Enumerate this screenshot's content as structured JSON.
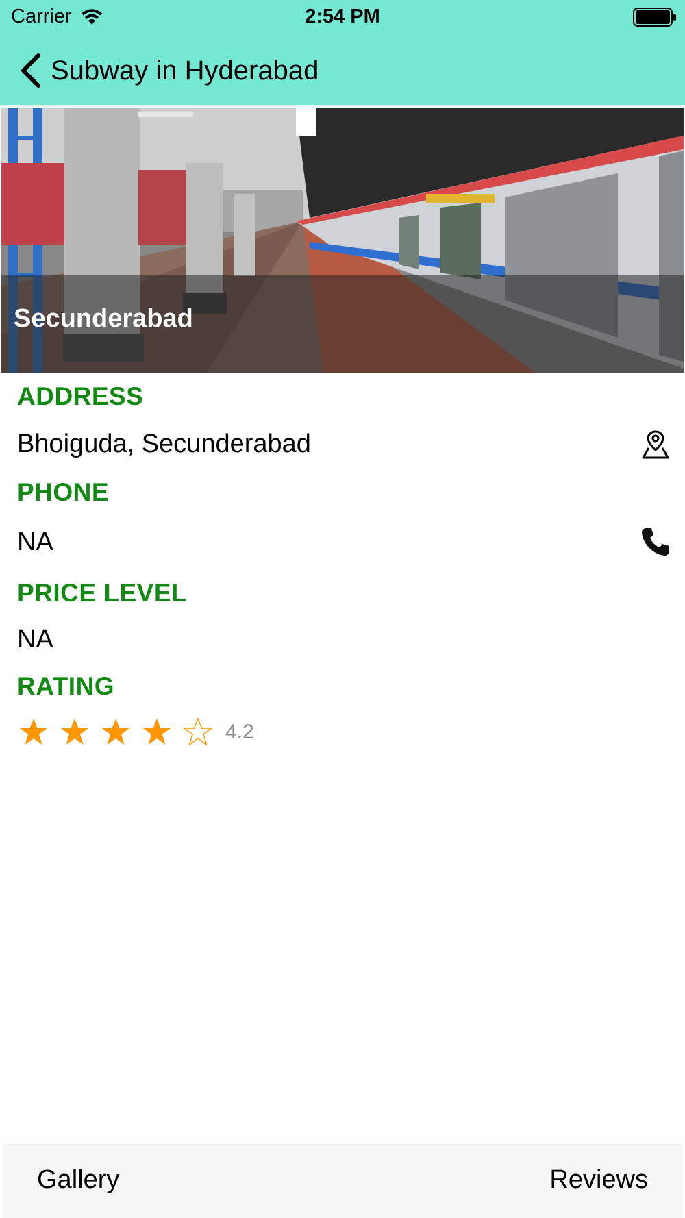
{
  "status_bar": {
    "carrier": "Carrier",
    "time": "2:54 PM",
    "wifi_icon": "wifi-icon",
    "battery_icon": "battery-icon"
  },
  "nav": {
    "back_icon": "chevron-left-icon",
    "title": "Subway in Hyderabad"
  },
  "hero": {
    "caption": "Secunderabad"
  },
  "details": {
    "address_label": "ADDRESS",
    "address_value": "Bhoiguda, Secunderabad",
    "address_icon": "map-pin-icon",
    "phone_label": "PHONE",
    "phone_value": "NA",
    "phone_icon": "phone-icon",
    "price_label": "PRICE LEVEL",
    "price_value": "NA",
    "rating_label": "RATING",
    "rating_value": "4.2",
    "rating_stars_filled": 4,
    "rating_stars_total": 5
  },
  "bottom_bar": {
    "gallery_label": "Gallery",
    "reviews_label": "Reviews"
  },
  "colors": {
    "header_bg": "#74e8d2",
    "section_label": "#108a10",
    "star_color": "#ff9500"
  }
}
